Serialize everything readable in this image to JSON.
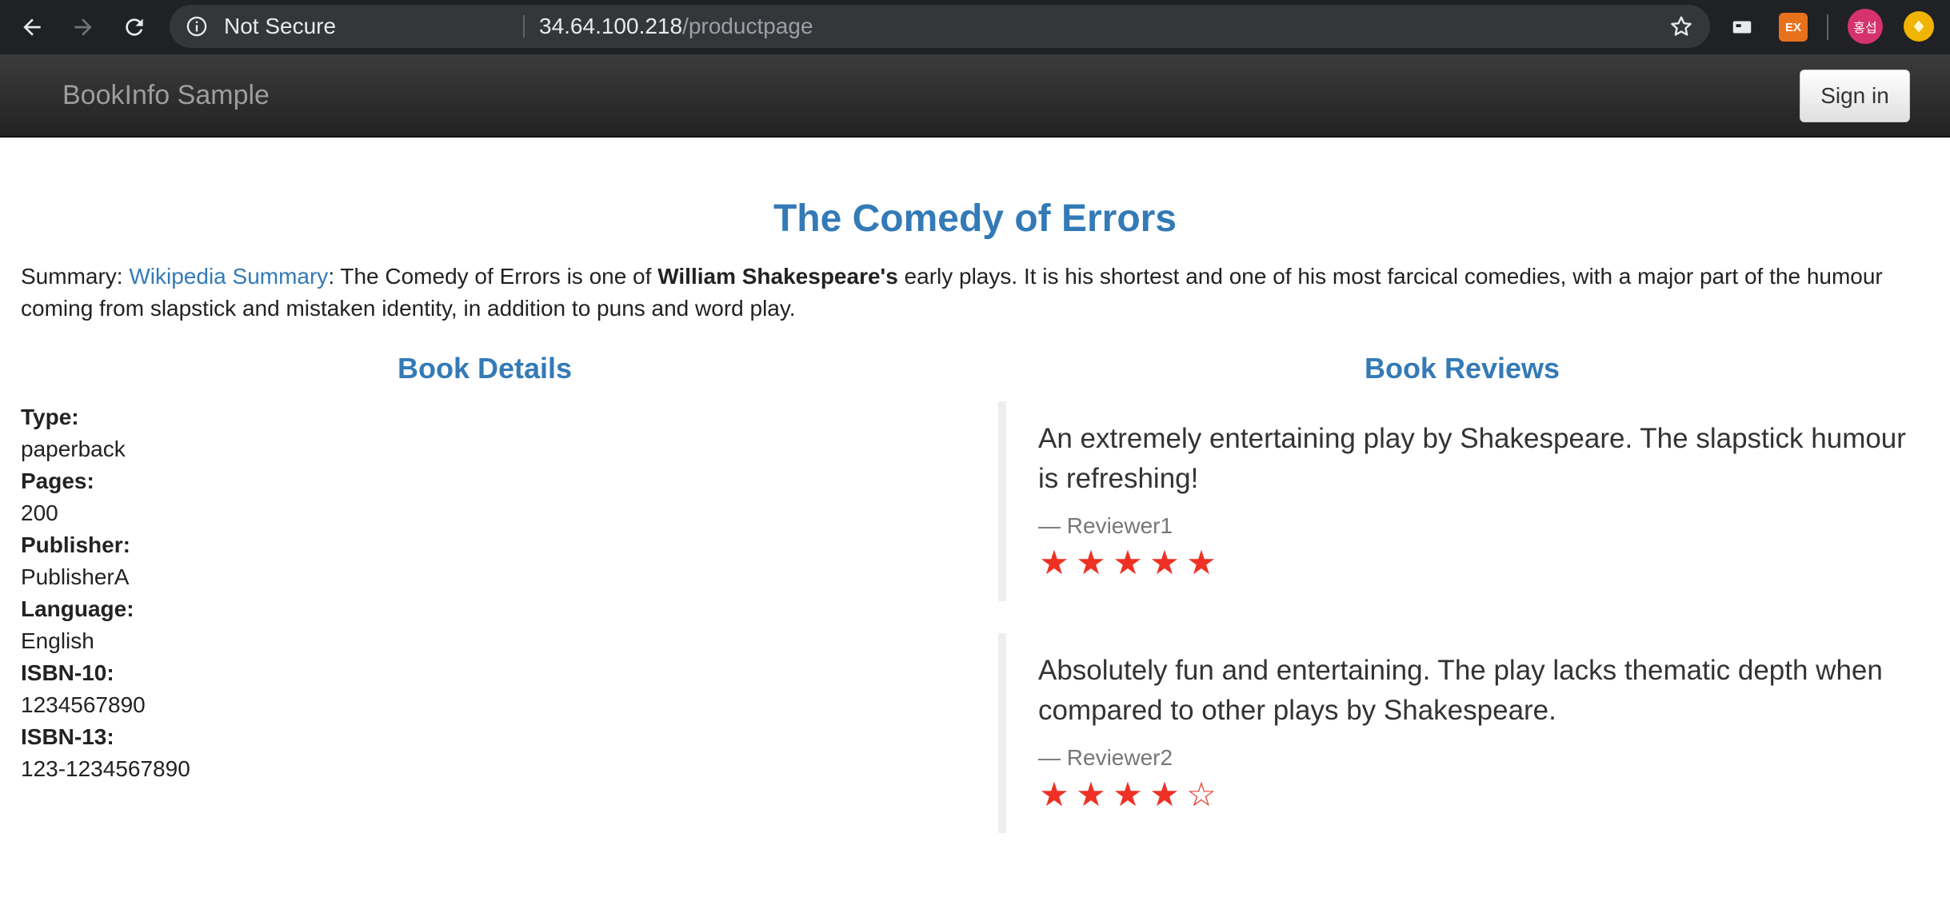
{
  "browser": {
    "security_label": "Not Secure",
    "url_host": "34.64.100.218",
    "url_path": "/productpage",
    "extension_label": "EX",
    "profile_label": "홍섭"
  },
  "navbar": {
    "brand": "BookInfo Sample",
    "signin_label": "Sign in"
  },
  "product": {
    "title": "The Comedy of Errors",
    "summary_prefix": "Summary: ",
    "summary_link": "Wikipedia Summary",
    "summary_text_1": ": The Comedy of Errors is one of ",
    "summary_bold": "William Shakespeare's",
    "summary_text_2": " early plays. It is his shortest and one of his most farcical comedies, with a major part of the humour coming from slapstick and mistaken identity, in addition to puns and word play."
  },
  "details": {
    "heading": "Book Details",
    "fields": [
      {
        "label": "Type:",
        "value": "paperback"
      },
      {
        "label": "Pages:",
        "value": "200"
      },
      {
        "label": "Publisher:",
        "value": "PublisherA"
      },
      {
        "label": "Language:",
        "value": "English"
      },
      {
        "label": "ISBN-10:",
        "value": "1234567890"
      },
      {
        "label": "ISBN-13:",
        "value": "123-1234567890"
      }
    ]
  },
  "reviews": {
    "heading": "Book Reviews",
    "items": [
      {
        "text": "An extremely entertaining play by Shakespeare. The slapstick humour is refreshing!",
        "reviewer": "— Reviewer1",
        "rating": 5,
        "max_rating": 5
      },
      {
        "text": "Absolutely fun and entertaining. The play lacks thematic depth when compared to other plays by Shakespeare.",
        "reviewer": "— Reviewer2",
        "rating": 4,
        "max_rating": 5
      }
    ],
    "star_color": "#ee3124"
  },
  "colors": {
    "accent": "#337ab7",
    "navbar": "#222222",
    "chrome": "#202124"
  },
  "icons": [
    "back-arrow-icon",
    "forward-arrow-icon",
    "reload-icon",
    "info-icon",
    "bookmark-star-icon",
    "cast-icon",
    "star-filled-icon",
    "star-empty-icon"
  ]
}
